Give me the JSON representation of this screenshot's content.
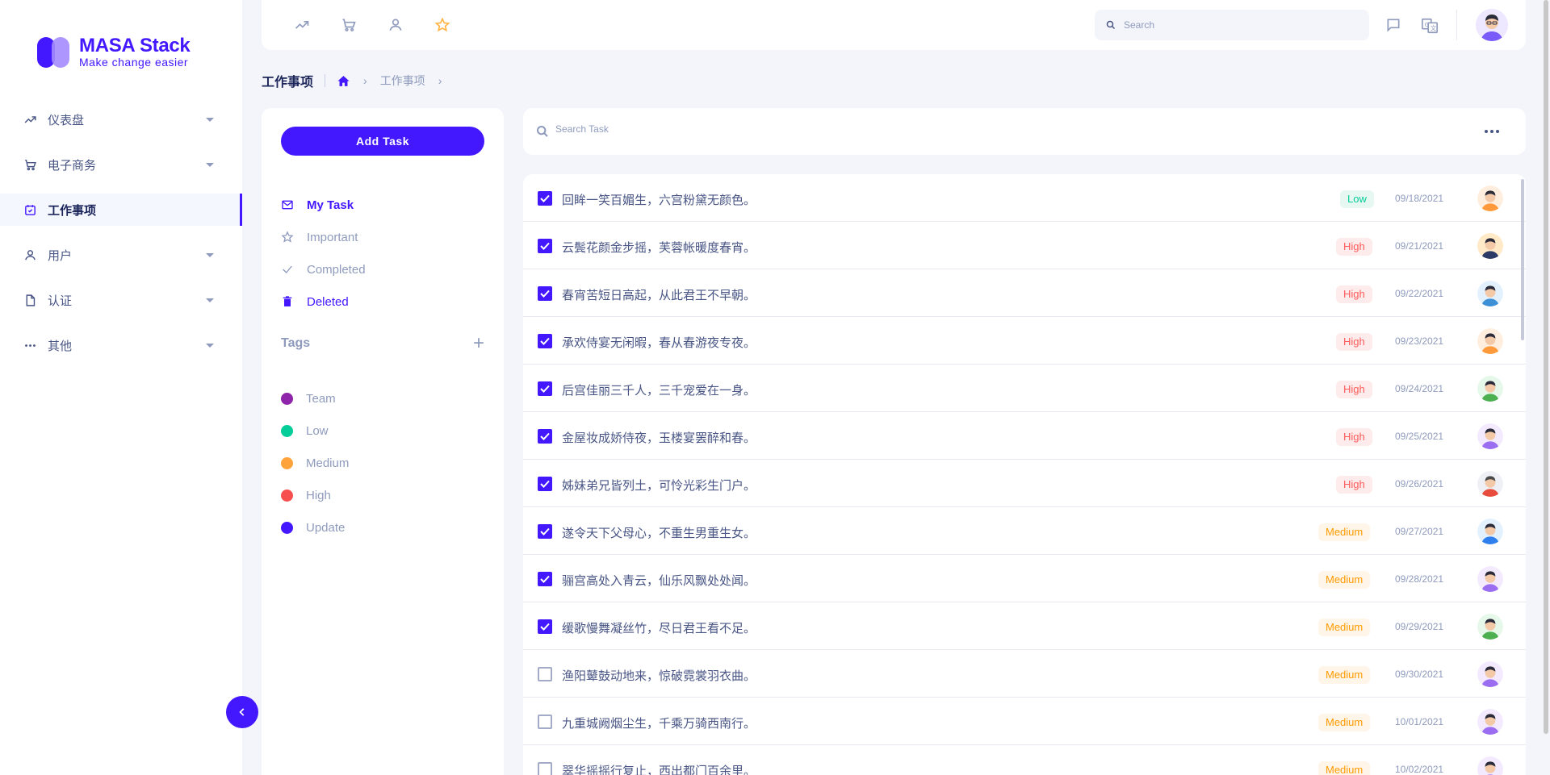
{
  "app": {
    "logo_title": "MASA Stack",
    "logo_tagline": "Make change easier",
    "brand_color": "#4318ff"
  },
  "sidebar": {
    "items": [
      {
        "label": "仪表盘",
        "icon": "trending-up-icon"
      },
      {
        "label": "电子商务",
        "icon": "cart-icon"
      },
      {
        "label": "工作事项",
        "icon": "calendar-check-icon",
        "active": true
      },
      {
        "label": "用户",
        "icon": "user-icon"
      },
      {
        "label": "认证",
        "icon": "document-icon"
      },
      {
        "label": "其他",
        "icon": "dots-icon"
      }
    ]
  },
  "topbar": {
    "search_placeholder": "Search",
    "icons": [
      "trending-up-icon",
      "cart-icon",
      "user-icon",
      "star-icon",
      "message-icon",
      "translate-icon"
    ]
  },
  "breadcrumb": {
    "title": "工作事项",
    "crumb": "工作事项"
  },
  "panel": {
    "add_task_label": "Add Task",
    "filters": [
      {
        "label": "My Task",
        "icon": "mail-icon"
      },
      {
        "label": "Important",
        "icon": "star-icon"
      },
      {
        "label": "Completed",
        "icon": "check-icon"
      },
      {
        "label": "Deleted",
        "icon": "trash-icon"
      }
    ],
    "tags_label": "Tags",
    "tags": [
      {
        "label": "Team",
        "color": "#8e24aa"
      },
      {
        "label": "Low",
        "color": "#05cd99"
      },
      {
        "label": "Medium",
        "color": "#ffa43a"
      },
      {
        "label": "High",
        "color": "#f74f4f"
      },
      {
        "label": "Update",
        "color": "#4318ff"
      }
    ]
  },
  "task_search": {
    "placeholder": "Search Task"
  },
  "tasks": [
    {
      "text": "回眸一笑百媚生，六宫粉黛无颜色。",
      "priority": "Low",
      "date": "09/18/2021",
      "done": true
    },
    {
      "text": "云鬓花颜金步摇，芙蓉帐暖度春宵。",
      "priority": "High",
      "date": "09/21/2021",
      "done": true
    },
    {
      "text": "春宵苦短日高起，从此君王不早朝。",
      "priority": "High",
      "date": "09/22/2021",
      "done": true
    },
    {
      "text": "承欢侍宴无闲暇，春从春游夜专夜。",
      "priority": "High",
      "date": "09/23/2021",
      "done": true
    },
    {
      "text": "后宫佳丽三千人，三千宠爱在一身。",
      "priority": "High",
      "date": "09/24/2021",
      "done": true
    },
    {
      "text": "金屋妆成娇侍夜，玉楼宴罢醉和春。",
      "priority": "High",
      "date": "09/25/2021",
      "done": true
    },
    {
      "text": "姊妹弟兄皆列土，可怜光彩生门户。",
      "priority": "High",
      "date": "09/26/2021",
      "done": true
    },
    {
      "text": "遂令天下父母心，不重生男重生女。",
      "priority": "Medium",
      "date": "09/27/2021",
      "done": true
    },
    {
      "text": "骊宫高处入青云，仙乐风飘处处闻。",
      "priority": "Medium",
      "date": "09/28/2021",
      "done": true
    },
    {
      "text": "缓歌慢舞凝丝竹，尽日君王看不足。",
      "priority": "Medium",
      "date": "09/29/2021",
      "done": true
    },
    {
      "text": "渔阳鼙鼓动地来，惊破霓裳羽衣曲。",
      "priority": "Medium",
      "date": "09/30/2021",
      "done": false
    },
    {
      "text": "九重城阙烟尘生，千乘万骑西南行。",
      "priority": "Medium",
      "date": "10/01/2021",
      "done": false
    },
    {
      "text": "翠华摇摇行复止，西出都门百余里。",
      "priority": "Medium",
      "date": "10/02/2021",
      "done": false
    }
  ]
}
